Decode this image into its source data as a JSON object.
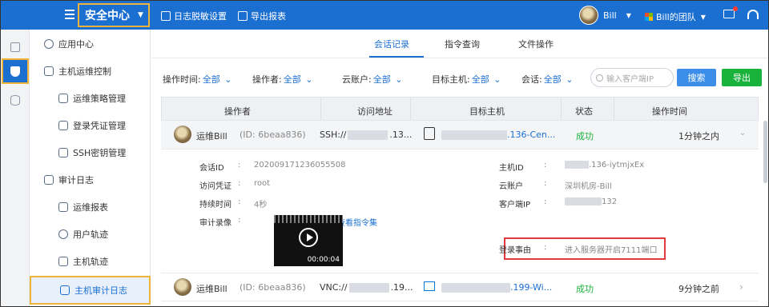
{
  "topbar": {
    "brand": "安全中心",
    "actions": [
      "日志脱敏设置",
      "导出报表"
    ],
    "user": "Bill",
    "team": "Bill的团队"
  },
  "rail": [
    "console-icon",
    "shield-icon",
    "database-icon"
  ],
  "menu": [
    {
      "label": "应用中心",
      "level": 1
    },
    {
      "label": "主机运维控制",
      "level": 1
    },
    {
      "label": "运维策略管理",
      "level": 2
    },
    {
      "label": "登录凭证管理",
      "level": 2
    },
    {
      "label": "SSH密钥管理",
      "level": 2
    },
    {
      "label": "审计日志",
      "level": 1
    },
    {
      "label": "运维报表",
      "level": 2
    },
    {
      "label": "用户轨迹",
      "level": 2
    },
    {
      "label": "主机轨迹",
      "level": 2
    },
    {
      "label": "主机审计日志",
      "level": 2,
      "active": true
    }
  ],
  "tabs": [
    "会话记录",
    "指令查询",
    "文件操作"
  ],
  "filters": {
    "op_time": {
      "label": "操作时间:",
      "value": "全部"
    },
    "operator": {
      "label": "操作者:",
      "value": "全部"
    },
    "cloud": {
      "label": "云账户:",
      "value": "全部"
    },
    "target": {
      "label": "目标主机:",
      "value": "全部"
    },
    "session": {
      "label": "会话:",
      "value": "全部"
    },
    "search_placeholder": "输入客户端IP",
    "search_btn": "搜索",
    "export_btn": "导出"
  },
  "table": {
    "headers": [
      "操作者",
      "访问地址",
      "目标主机",
      "状态",
      "操作时间"
    ],
    "rows": [
      {
        "user": "运维Bill",
        "id": "(ID: 6beaa836)",
        "addr_prefix": "SSH://",
        "addr_suffix": ".13...",
        "host_suffix": ".136-Cen...",
        "status": "成功",
        "time": "1分钟之内"
      },
      {
        "user": "运维Bill",
        "id": "(ID: 6beaa836)",
        "addr_prefix": "VNC://",
        "addr_suffix": ".19...",
        "host_suffix": ".199-Wi...",
        "status": "成功",
        "time": "9分钟之前"
      }
    ]
  },
  "detail": {
    "session_id_label": "会话ID",
    "session_id": "20200917123605550​8",
    "credential_label": "访问凭证",
    "credential": "root",
    "duration_label": "持续时间",
    "duration": "4秒",
    "record_label": "审计录像",
    "view_commands": "查看指令集",
    "video_time": "00:00:04",
    "host_id_label": "主机ID",
    "host_id_suffix": ".136-iytmjxEx",
    "cloud_label": "云账户",
    "cloud": "深圳机房-Bill",
    "client_ip_label": "客户端IP",
    "client_ip_suffix": "132",
    "reason_label": "登录事由",
    "reason": "进入服务器开启7111端口"
  },
  "colors": {
    "brand": "#1b6fd1",
    "highlight": "#f0b43a",
    "alert": "#e03a3a",
    "success": "#19b23b"
  }
}
